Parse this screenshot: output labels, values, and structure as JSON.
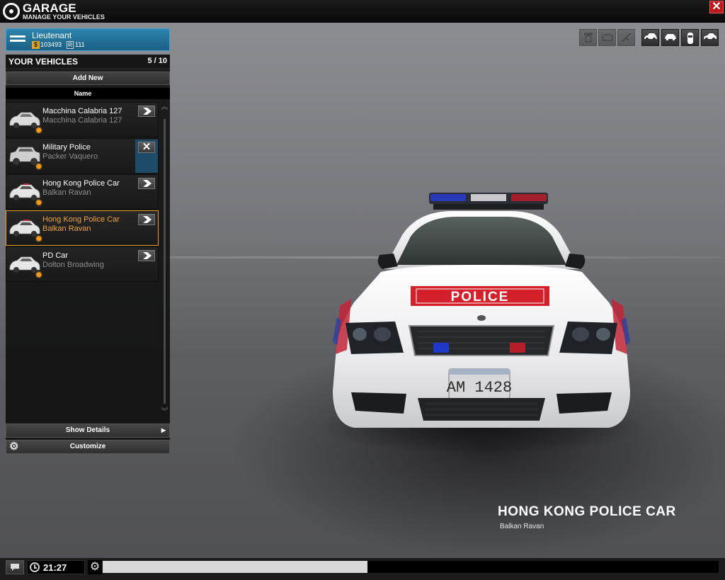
{
  "header": {
    "title": "GARAGE",
    "subtitle": "MANAGE YOUR VEHICLES",
    "close_label": "✕"
  },
  "player": {
    "rank": "Lieutenant",
    "money": "103493",
    "money_icon": "$",
    "rep_icon": "R",
    "rep": "111"
  },
  "vehicles_panel": {
    "title": "YOUR VEHICLES",
    "count": "5 / 10",
    "add_new_label": "Add New",
    "column_header": "Name",
    "items": [
      {
        "name": "Macchina Calabria 127",
        "model": "Macchina Calabria 127",
        "action": "select"
      },
      {
        "name": "Military Police",
        "model": "Packer Vaquero",
        "action": "delete"
      },
      {
        "name": "Hong Kong Police Car",
        "model": "Balkan Ravan",
        "action": "select"
      },
      {
        "name": "Hong Kong Police Car",
        "model": "Balkan Ravan",
        "action": "select",
        "selected": true
      },
      {
        "name": "PD Car",
        "model": "Dolton Broadwing",
        "action": "select"
      }
    ],
    "show_details_label": "Show Details",
    "customize_label": "Customize"
  },
  "view_toolbar": {
    "buttons": [
      "driver-view-icon",
      "engine-view-icon",
      "trunk-view-icon",
      "front-three-quarter-icon",
      "front-view-icon",
      "top-view-icon",
      "side-view-icon"
    ]
  },
  "caption": {
    "vehicle_name": "HONG KONG POLICE CAR",
    "vehicle_model": "Balkan Ravan"
  },
  "car_display": {
    "hood_text": "POLICE",
    "plate_text": "AM 1428"
  },
  "status_bar": {
    "time": "21:27",
    "progress": 0.43
  },
  "colors": {
    "accent_blue": "#2c84ad",
    "selected_orange": "#e39a2b",
    "close_red": "#b71a1a",
    "police_red": "#d4202a"
  }
}
